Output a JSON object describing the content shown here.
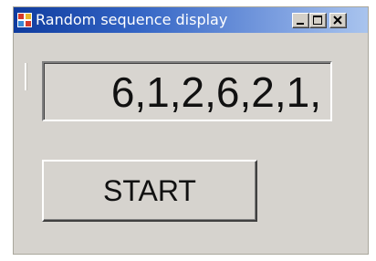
{
  "window": {
    "title": "Random sequence display"
  },
  "display": {
    "sequence": "6,1,2,6,2,1,"
  },
  "buttons": {
    "start_label": "START"
  },
  "icons": {
    "app": "app-grid-icon",
    "minimize": "minimize-icon",
    "maximize": "maximize-icon",
    "close": "close-icon"
  },
  "colors": {
    "title_bar_start": "#0f3b9e",
    "title_bar_end": "#a9c4ee",
    "face": "#d6d3ce",
    "app_icon": [
      "#d63a2a",
      "#e8b92a",
      "#3a8ad6",
      "#d63a2a"
    ]
  }
}
